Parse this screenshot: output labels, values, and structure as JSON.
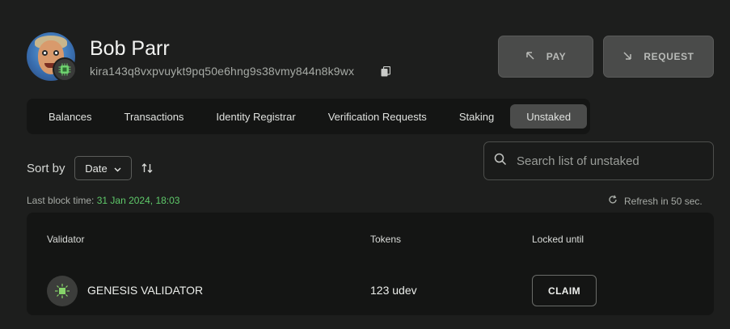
{
  "profile": {
    "name": "Bob Parr",
    "address": "kira143q8vxpvuykt9pq50e6hng9s38vmy844n8k9wx",
    "avatar_icon": "avatar-icon",
    "badge_icon": "chip-icon",
    "copy_icon": "copy-icon"
  },
  "actions": {
    "pay_label": "PAY",
    "request_label": "REQUEST"
  },
  "tabs": [
    {
      "label": "Balances",
      "active": false
    },
    {
      "label": "Transactions",
      "active": false
    },
    {
      "label": "Identity Registrar",
      "active": false
    },
    {
      "label": "Verification Requests",
      "active": false
    },
    {
      "label": "Staking",
      "active": false
    },
    {
      "label": "Unstaked",
      "active": true
    }
  ],
  "sort": {
    "label": "Sort by",
    "selected": "Date"
  },
  "search": {
    "placeholder": "Search list of unstaked",
    "value": ""
  },
  "status": {
    "block_time_label": "Last block time:",
    "block_time_value": "31 Jan 2024, 18:03",
    "refresh_text": "Refresh in 50 sec."
  },
  "table": {
    "columns": [
      "Validator",
      "Tokens",
      "Locked until"
    ],
    "rows": [
      {
        "validator": "GENESIS VALIDATOR",
        "tokens": "123 udev",
        "action": "CLAIM"
      }
    ]
  },
  "colors": {
    "background": "#1d1e1d",
    "panel": "#141514",
    "accent_green": "#5fc96a",
    "active_tab": "#4b4c4b"
  }
}
